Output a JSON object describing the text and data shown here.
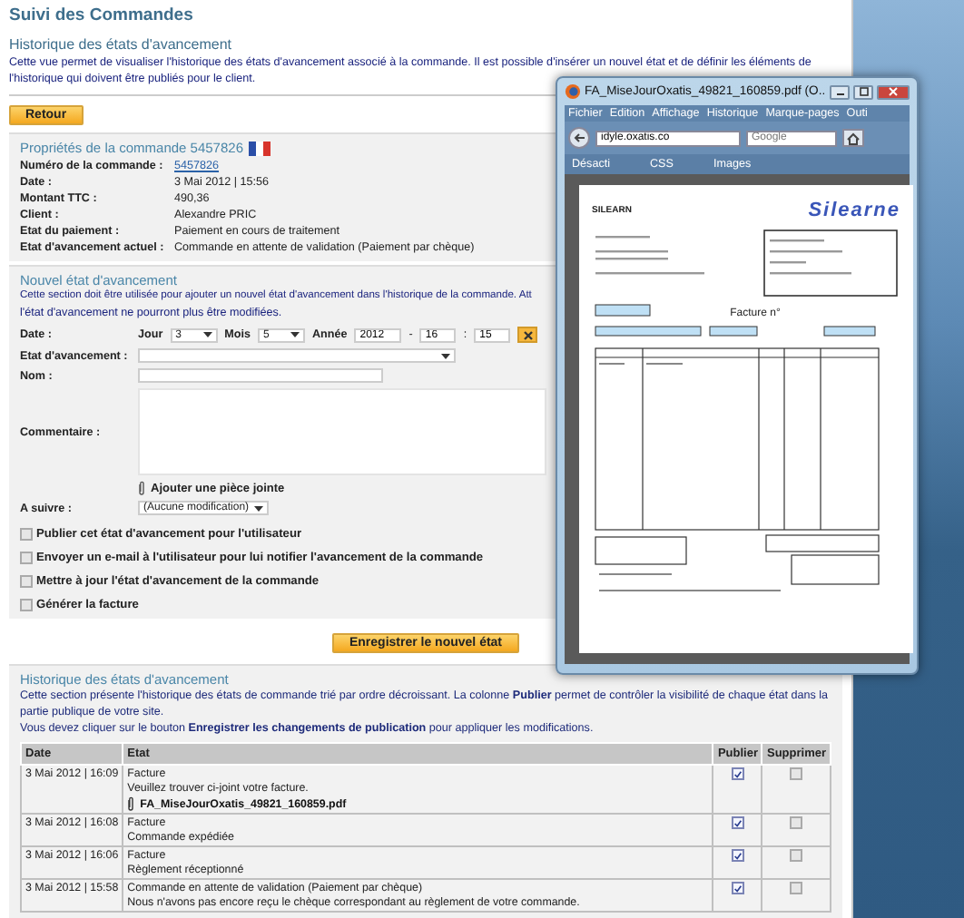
{
  "page": {
    "title": "Suivi des Commandes"
  },
  "intro": {
    "heading": "Historique des états d'avancement",
    "text": "Cette vue permet de visualiser l'historique des états d'avancement associé à la commande. Il est possible d'insérer un nouvel état et de définir les éléments de l'historique qui doivent être publiés pour le client."
  },
  "back_button": "Retour",
  "properties": {
    "heading": "Propriétés de la commande 5457826",
    "fields": [
      {
        "label": "Numéro de la commande :",
        "value": "5457826",
        "kind": "link"
      },
      {
        "label": "Date :",
        "value": "3 Mai 2012 | 15:56",
        "kind": "text"
      },
      {
        "label": "Montant TTC :",
        "value": "490,36",
        "kind": "text"
      },
      {
        "label": "Client :",
        "value": "Alexandre PRIC",
        "kind": "text"
      },
      {
        "label": "Etat du paiement :",
        "value": "Paiement en cours de traitement",
        "kind": "text"
      },
      {
        "label": "Etat d'avancement actuel :",
        "value": "Commande en attente de validation (Paiement par chèque)",
        "kind": "text"
      }
    ]
  },
  "new_state": {
    "heading": "Nouvel état d'avancement",
    "text": "Cette section doit être utilisée pour ajouter un nouvel état d'avancement dans l'historique de la commande. Att",
    "text2": "l'état d'avancement ne pourront plus être modifiées.",
    "date_label": "Date :",
    "day_label": "Jour",
    "day": "3",
    "month_label": "Mois",
    "month": "5",
    "year_label": "Année",
    "year": "2012",
    "date_separator": "-",
    "hour": "16",
    "time_separator": ":",
    "minute": "15",
    "state_label": "Etat d'avancement :",
    "name_label": "Nom :",
    "comment_label": "Commentaire :",
    "attach_link": "Ajouter une pièce jointe",
    "follow_label": "A suivre :",
    "follow_value": "(Aucune modification)",
    "options": [
      {
        "label": "Publier cet état d'avancement pour l'utilisateur",
        "checked": false
      },
      {
        "label": "Envoyer un e-mail à l'utilisateur pour lui notifier l'avancement de la commande",
        "checked": false
      },
      {
        "label": "Mettre à jour l'état d'avancement de la commande",
        "checked": false
      },
      {
        "label": "Générer la facture",
        "checked": false
      }
    ],
    "submit_button": "Enregistrer le nouvel état"
  },
  "history": {
    "heading": "Historique des états d'avancement",
    "text": "Cette section présente l'historique des états de commande trié par ordre décroissant. La colonne **Publier** permet de contrôler la visibilité de chaque état dans la partie publique de votre site.",
    "text2": "Vous devez cliquer sur le bouton **Enregistrer les changements de publication** pour appliquer les modifications.",
    "columns": [
      "Date",
      "Etat",
      "Publier",
      "Supprimer"
    ],
    "rows": [
      {
        "date": "3 Mai 2012 | 16:09",
        "lines": [
          "Facture",
          "Veuillez trouver ci-joint votre facture."
        ],
        "attachment": "FA_MiseJourOxatis_49821_160859.pdf",
        "publish": true,
        "delete": false
      },
      {
        "date": "3 Mai 2012 | 16:08",
        "lines": [
          "Facture",
          "Commande expédiée"
        ],
        "publish": true,
        "delete": false
      },
      {
        "date": "3 Mai 2012 | 16:06",
        "lines": [
          "Facture",
          "Règlement réceptionné"
        ],
        "publish": true,
        "delete": false
      },
      {
        "date": "3 Mai 2012 | 15:58",
        "lines": [
          "Commande en attente de validation (Paiement par chèque)",
          "Nous n'avons pas encore reçu le chèque correspondant au règlement de votre commande."
        ],
        "publish": true,
        "delete": false
      }
    ]
  },
  "browser": {
    "title": "FA_MiseJourOxatis_49821_160859.pdf (O...",
    "menu": [
      "Fichier",
      "Edition",
      "Affichage",
      "Historique",
      "Marque-pages",
      "Outi"
    ],
    "address": "idyle.oxatis.co",
    "search_placeholder": "Google",
    "bookmarks": [
      "Désacti",
      "CSS",
      "Images"
    ],
    "document": {
      "company": "SILEARN",
      "logo": "Silearne",
      "invoice_title": "Facture n°"
    }
  }
}
